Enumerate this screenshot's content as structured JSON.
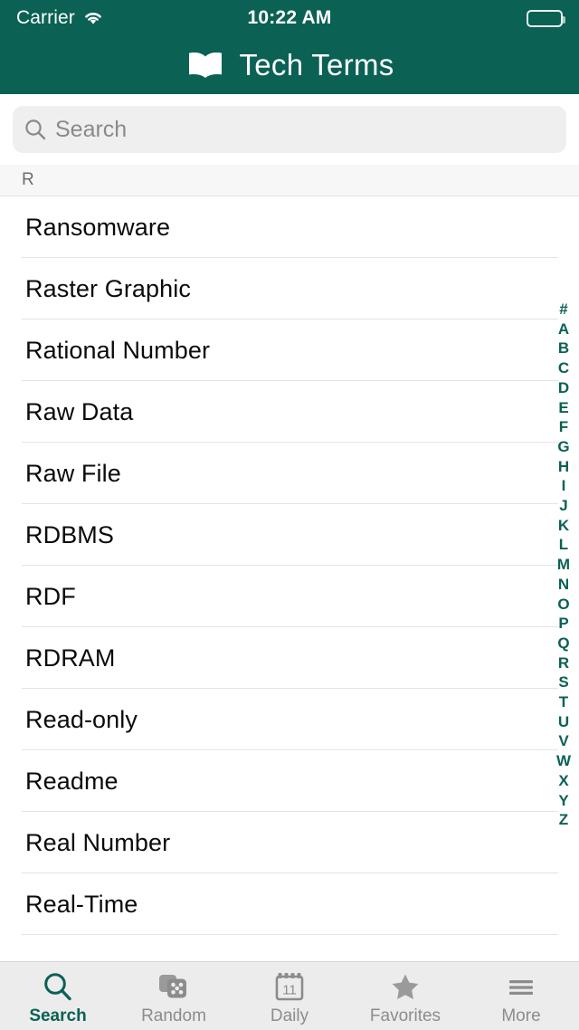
{
  "status_bar": {
    "carrier": "Carrier",
    "time": "10:22 AM",
    "wifi_icon": "wifi-icon",
    "battery_icon": "battery-icon"
  },
  "nav_bar": {
    "title": "Tech Terms",
    "book_icon": "open-book-icon",
    "background_color": "#0a6154"
  },
  "search": {
    "placeholder": "Search",
    "value": "",
    "icon": "search-icon"
  },
  "list": {
    "section_title": "R",
    "items": [
      {
        "term": "Ransomware"
      },
      {
        "term": "Raster Graphic"
      },
      {
        "term": "Rational Number"
      },
      {
        "term": "Raw Data"
      },
      {
        "term": "Raw File"
      },
      {
        "term": "RDBMS"
      },
      {
        "term": "RDF"
      },
      {
        "term": "RDRAM"
      },
      {
        "term": "Read-only"
      },
      {
        "term": "Readme"
      },
      {
        "term": "Real Number"
      },
      {
        "term": "Real-Time"
      }
    ]
  },
  "index": {
    "letters": [
      "#",
      "A",
      "B",
      "C",
      "D",
      "E",
      "F",
      "G",
      "H",
      "I",
      "J",
      "K",
      "L",
      "M",
      "N",
      "O",
      "P",
      "Q",
      "R",
      "S",
      "T",
      "U",
      "V",
      "W",
      "X",
      "Y",
      "Z"
    ],
    "color": "#0a6154"
  },
  "tab_bar": {
    "tabs": [
      {
        "label": "Search",
        "icon": "magnifier-icon",
        "active": true
      },
      {
        "label": "Random",
        "icon": "dice-icon",
        "active": false
      },
      {
        "label": "Daily",
        "icon": "calendar-icon",
        "active": false
      },
      {
        "label": "Favorites",
        "icon": "star-icon",
        "active": false
      },
      {
        "label": "More",
        "icon": "hamburger-icon",
        "active": false
      }
    ],
    "calendar_day": "11",
    "active_color": "#0a6154",
    "inactive_color": "#8c8c8c"
  }
}
